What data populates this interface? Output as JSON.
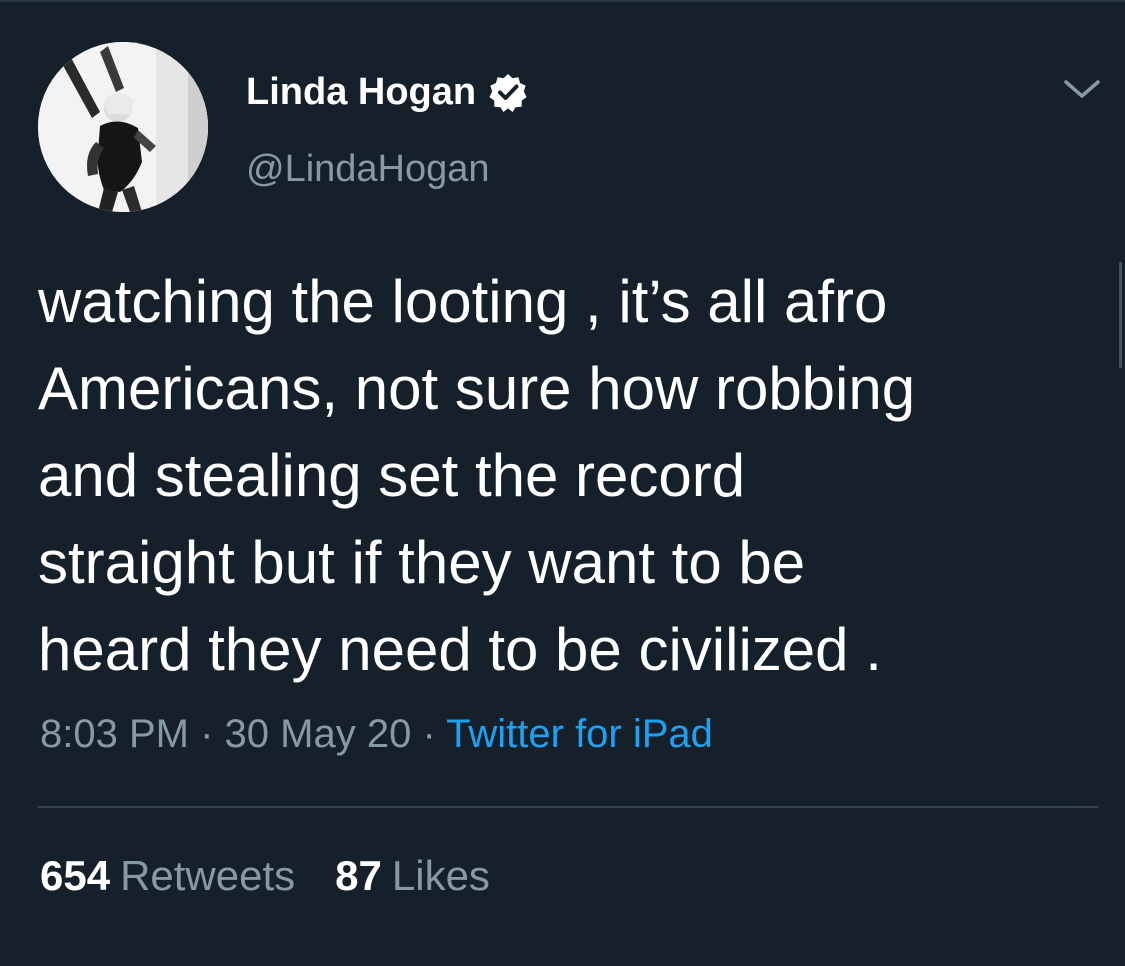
{
  "tweet": {
    "author": {
      "display_name": "Linda Hogan",
      "handle": "@LindaHogan",
      "verified": true
    },
    "text_lines": [
      "watching the looting , it’s all afro",
      "Americans, not sure how robbing",
      "and stealing set the record",
      "straight but if they want to be",
      "heard they need to be civilized ."
    ],
    "time": "8:03 PM",
    "date": "30 May 20",
    "separator": "·",
    "source": "Twitter for iPad",
    "retweets": {
      "count": "654",
      "label": "Retweets"
    },
    "likes": {
      "count": "87",
      "label": "Likes"
    }
  },
  "icons": {
    "verified": "verified-badge-icon",
    "menu": "chevron-down-icon"
  },
  "colors": {
    "background": "#15202b",
    "text_primary": "#ffffff",
    "text_secondary": "#8899a6",
    "link": "#1da1f2",
    "divider": "#38444d"
  }
}
